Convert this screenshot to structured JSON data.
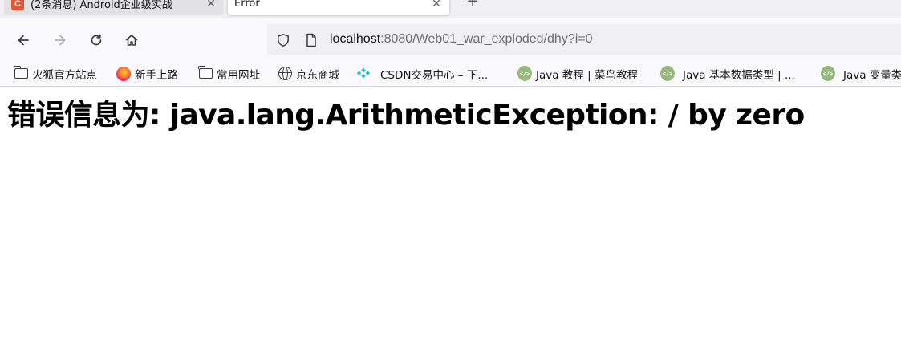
{
  "tabs": [
    {
      "title": "(2条消息) Android企业级实战",
      "favicon": "csdn-c-icon",
      "active": false
    },
    {
      "title": "Error",
      "active": true
    }
  ],
  "toolbar": {
    "url_host": "localhost",
    "url_rest": ":8080/Web01_war_exploded/dhy?i=0"
  },
  "bookmarks": [
    {
      "label": "火狐官方站点",
      "icon": "folder-icon"
    },
    {
      "label": "新手上路",
      "icon": "firefox-icon"
    },
    {
      "label": "常用网址",
      "icon": "folder-icon"
    },
    {
      "label": "京东商城",
      "icon": "globe-icon"
    },
    {
      "label": "CSDN交易中心 – 下...",
      "icon": "csdn-icon"
    },
    {
      "label": "Java 教程 | 菜鸟教程",
      "icon": "runoob-icon"
    },
    {
      "label": "Java 基本数据类型 | ...",
      "icon": "runoob-icon"
    },
    {
      "label": "Java 变量类型",
      "icon": "runoob-icon"
    }
  ],
  "page": {
    "heading": "错误信息为: java.lang.ArithmeticException: / by zero"
  },
  "colors": {
    "tab_strip": "#f0f0f4",
    "toolbar": "#f9f9fb",
    "url_bar": "#f0f0f4",
    "csdn_red": "#e8542f",
    "runoob_green": "#96b97d"
  }
}
